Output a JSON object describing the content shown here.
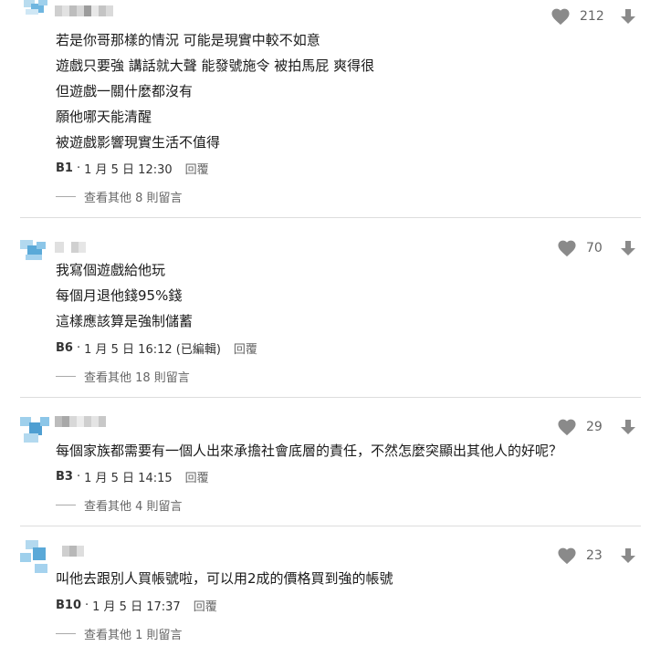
{
  "comments": [
    {
      "lines": [
        "若是你哥那樣的情況 可能是現實中較不如意",
        "遊戲只要強 講話就大聲 能發號施令 被拍馬屁 爽得很",
        "但遊戲一關什麼都沒有",
        "願他哪天能清醒",
        "被遊戲影響現實生活不值得"
      ],
      "floor": "B1",
      "time": "1 月 5 日 12:30",
      "reply": "回覆",
      "likes": "212",
      "more": "查看其他 8 則留言"
    },
    {
      "lines": [
        "我寫個遊戲給他玩",
        "每個月退他錢95%錢",
        "這樣應該算是強制儲蓄"
      ],
      "floor": "B6",
      "time": "1 月 5 日 16:12 (已編輯)",
      "reply": "回覆",
      "likes": "70",
      "more": "查看其他 18 則留言"
    },
    {
      "lines": [
        "每個家族都需要有一個人出來承擔社會底層的責任，不然怎麼突顯出其他人的好呢？"
      ],
      "floor": "B3",
      "time": "1 月 5 日 14:15",
      "reply": "回覆",
      "likes": "29",
      "more": "查看其他 4 則留言"
    },
    {
      "lines": [
        "叫他去跟別人買帳號啦，可以用2成的價格買到強的帳號"
      ],
      "floor": "B10",
      "time": "1 月 5 日 17:37",
      "reply": "回覆",
      "likes": "23",
      "more": "查看其他 1 則留言"
    }
  ],
  "colors": {
    "text": "#1a1a1a",
    "meta": "#333333",
    "muted": "#666666",
    "icon": "#8a8a8a",
    "divider": "#dddddd",
    "avatar_blue": "#5aa9d8"
  },
  "icons": {
    "like": "heart-icon",
    "dislike": "arrow-down-icon"
  }
}
